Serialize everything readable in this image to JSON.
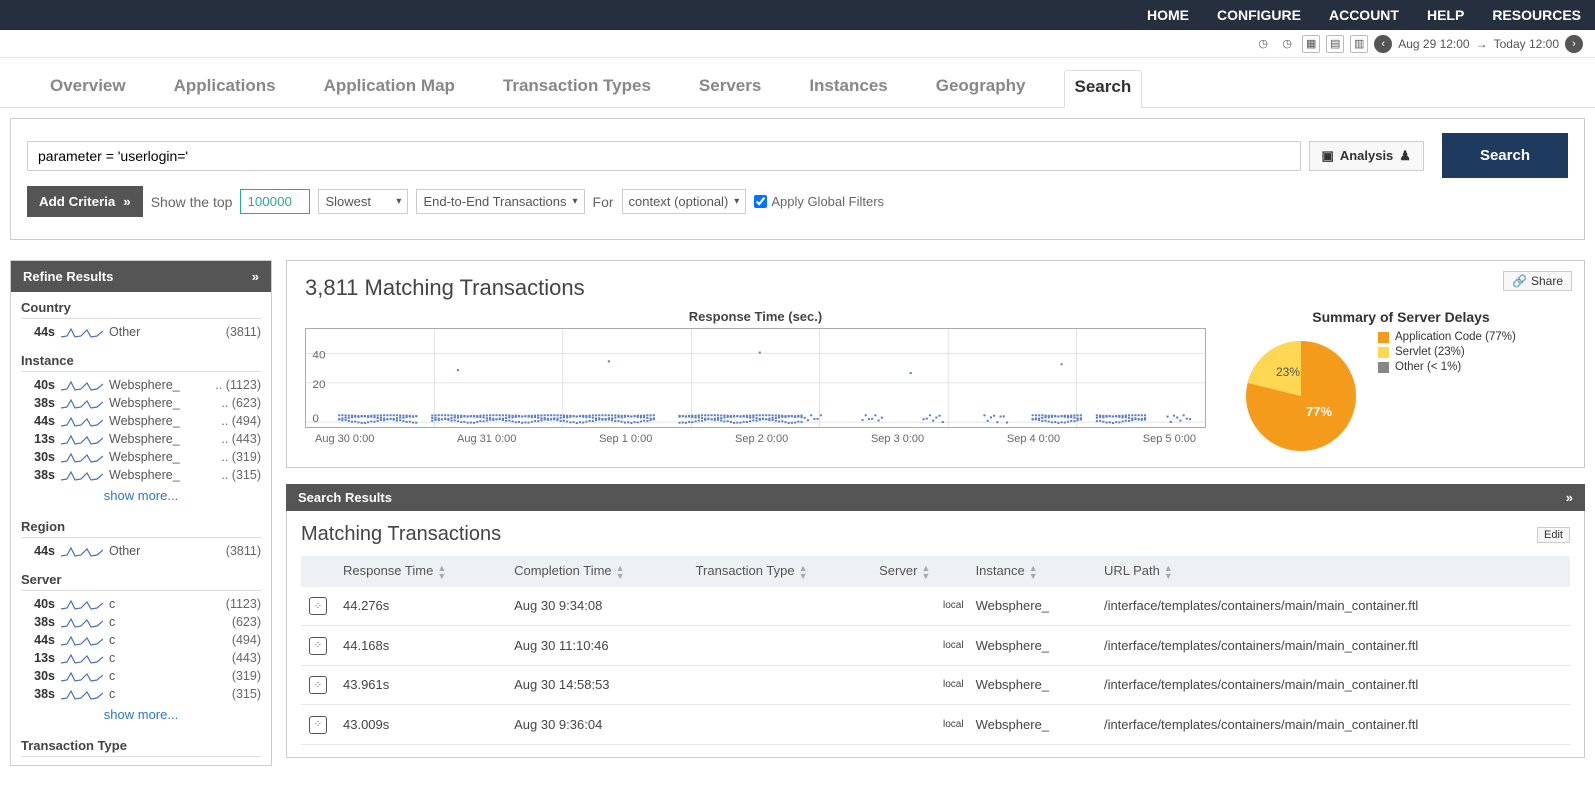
{
  "topnav": [
    "HOME",
    "CONFIGURE",
    "ACCOUNT",
    "HELP",
    "RESOURCES"
  ],
  "timerange": {
    "from": "Aug 29 12:00",
    "to": "Today 12:00"
  },
  "tabs": [
    "Overview",
    "Applications",
    "Application Map",
    "Transaction Types",
    "Servers",
    "Instances",
    "Geography",
    "Search"
  ],
  "active_tab": "Search",
  "query": "parameter = 'userlogin='",
  "analysis_btn": "Analysis",
  "search_btn": "Search",
  "add_criteria": "Add Criteria",
  "show_top_label": "Show the top",
  "top_n": "100000",
  "sort": "Slowest",
  "scope": "End-to-End Transactions",
  "for_label": "For",
  "context": "context (optional)",
  "apply_filters": "Apply Global Filters",
  "refine_header": "Refine Results",
  "facets": {
    "Country": [
      {
        "v": "44s",
        "name": "Other",
        "cnt": "(3811)"
      }
    ],
    "Instance": [
      {
        "v": "40s",
        "name": "Websphere_",
        "cnt": ".. (1123)"
      },
      {
        "v": "38s",
        "name": "Websphere_",
        "cnt": ".. (623)"
      },
      {
        "v": "44s",
        "name": "Websphere_",
        "cnt": ".. (494)"
      },
      {
        "v": "13s",
        "name": "Websphere_",
        "cnt": ".. (443)"
      },
      {
        "v": "30s",
        "name": "Websphere_",
        "cnt": ".. (319)"
      },
      {
        "v": "38s",
        "name": "Websphere_",
        "cnt": ".. (315)"
      }
    ],
    "Region": [
      {
        "v": "44s",
        "name": "Other",
        "cnt": "(3811)"
      }
    ],
    "Server": [
      {
        "v": "40s",
        "name": "c",
        "cnt": "(1123)"
      },
      {
        "v": "38s",
        "name": "c",
        "cnt": "(623)"
      },
      {
        "v": "44s",
        "name": "c",
        "cnt": "(494)"
      },
      {
        "v": "13s",
        "name": "c",
        "cnt": "(443)"
      },
      {
        "v": "30s",
        "name": "c",
        "cnt": "(319)"
      },
      {
        "v": "38s",
        "name": "c",
        "cnt": "(315)"
      }
    ],
    "Transaction Type": []
  },
  "show_more": "show more...",
  "matching_title": "3,811 Matching Transactions",
  "share": "Share",
  "scatter_title": "Response Time (sec.)",
  "pie_title": "Summary of Server Delays",
  "pie_legend": [
    {
      "label": "Application Code (77%)",
      "color": "#f59b1c"
    },
    {
      "label": "Servlet (23%)",
      "color": "#ffd753"
    },
    {
      "label": "Other (< 1%)",
      "color": "#888888"
    }
  ],
  "search_results_hdr": "Search Results",
  "mt_title": "Matching Transactions",
  "edit": "Edit",
  "columns": [
    "Response Time",
    "Completion Time",
    "Transaction Type",
    "Server",
    "Instance",
    "URL Path"
  ],
  "rows": [
    {
      "rt": "44.276s",
      "ct": "Aug 30 9:34:08",
      "tt": "",
      "srv": "local",
      "inst": "Websphere_",
      "url": "/interface/templates/containers/main/main_container.ftl"
    },
    {
      "rt": "44.168s",
      "ct": "Aug 30 11:10:46",
      "tt": "",
      "srv": "local",
      "inst": "Websphere_",
      "url": "/interface/templates/containers/main/main_container.ftl"
    },
    {
      "rt": "43.961s",
      "ct": "Aug 30 14:58:53",
      "tt": "",
      "srv": "local",
      "inst": "Websphere_",
      "url": "/interface/templates/containers/main/main_container.ftl"
    },
    {
      "rt": "43.009s",
      "ct": "Aug 30 9:36:04",
      "tt": "",
      "srv": "local",
      "inst": "Websphere_",
      "url": "/interface/templates/containers/main/main_container.ftl"
    }
  ],
  "chart_data": {
    "scatter": {
      "type": "scatter",
      "title": "Response Time (sec.)",
      "ylabel": "sec",
      "ylim": [
        0,
        45
      ],
      "yticks": [
        0,
        20,
        40
      ],
      "xticks": [
        "Aug 30 0:00",
        "Aug 31 0:00",
        "Sep 1 0:00",
        "Sep 2 0:00",
        "Sep 3 0:00",
        "Sep 4 0:00",
        "Sep 5 0:00"
      ],
      "note": "dense scatter of ~3811 points mostly near y=0-5 with occasional spikes up to ~44"
    },
    "pie": {
      "type": "pie",
      "title": "Summary of Server Delays",
      "series": [
        {
          "name": "Application Code",
          "value": 77,
          "color": "#f59b1c"
        },
        {
          "name": "Servlet",
          "value": 23,
          "color": "#ffd753"
        },
        {
          "name": "Other",
          "value": 0.5,
          "color": "#888888"
        }
      ],
      "labels": [
        "77%",
        "23%"
      ]
    }
  }
}
